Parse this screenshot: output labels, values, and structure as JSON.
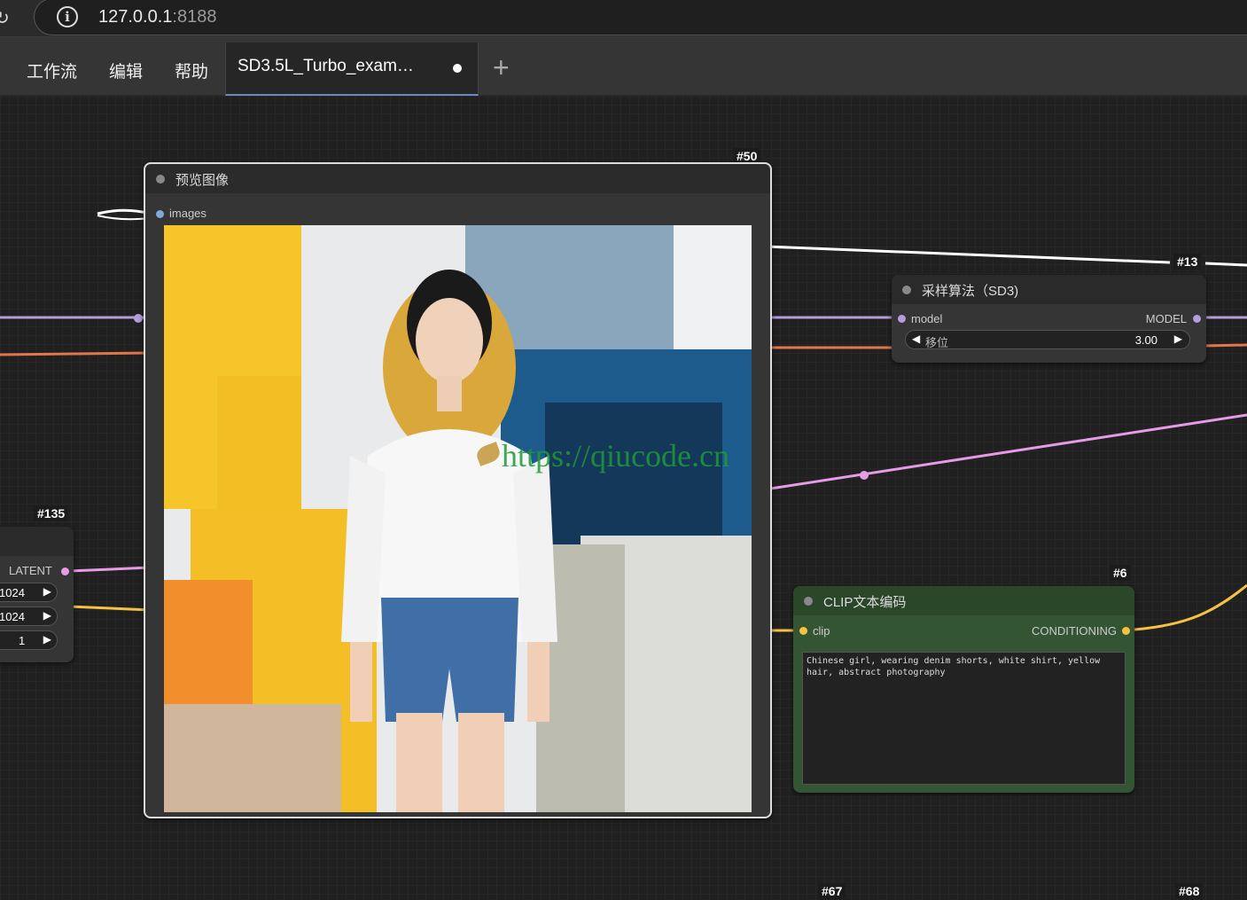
{
  "browser": {
    "url_host": "127.0.0.1",
    "url_port": ":8188"
  },
  "menu": {
    "items": [
      "工作流",
      "编辑",
      "帮助"
    ],
    "active_tab": "SD3.5L_Turbo_exam…"
  },
  "nodes": {
    "preview": {
      "id": "#50",
      "title": "预览图像",
      "input": "images"
    },
    "sampling": {
      "id": "#13",
      "title": "采样算法（SD3)",
      "input": "model",
      "output": "MODEL",
      "widget_label": "移位",
      "widget_value": "3.00"
    },
    "latent": {
      "id": "#135",
      "output": "LATENT",
      "values": [
        "1024",
        "1024",
        "1"
      ]
    },
    "clip": {
      "id": "#6",
      "title": "CLIP文本编码",
      "input": "clip",
      "output": "CONDITIONING",
      "text": "Chinese girl, wearing denim shorts, white shirt, yellow\nhair, abstract photography"
    },
    "bottom_ids": [
      "#67",
      "#68"
    ]
  },
  "watermark": "https://qiucode.cn",
  "colors": {
    "model_link": "#b39ddb",
    "latent_link": "#e69be6",
    "clip_link": "#f5c242",
    "orange_link": "#e0764a"
  }
}
